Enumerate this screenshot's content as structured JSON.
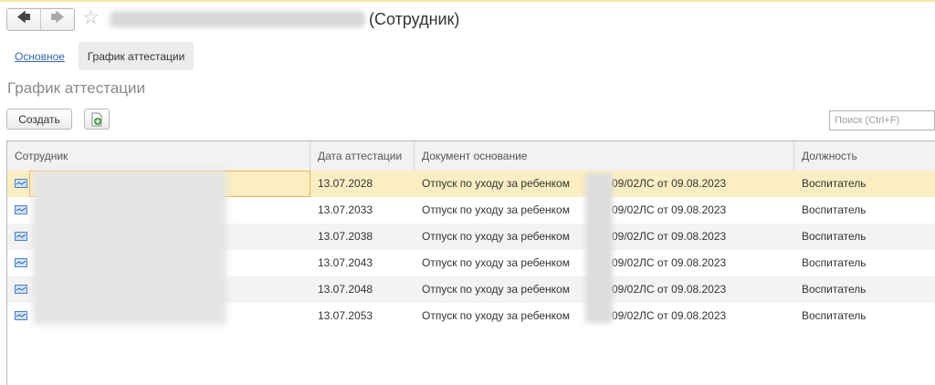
{
  "nav": {
    "back_icon": "arrow-left-icon",
    "forward_icon": "arrow-right-icon",
    "favorite_icon": "star-icon"
  },
  "header": {
    "title": "(Сотрудник)"
  },
  "tabs": [
    {
      "label": "Основное",
      "active": false
    },
    {
      "label": "График аттестации",
      "active": true
    }
  ],
  "section": {
    "title": "График аттестации"
  },
  "toolbar": {
    "create_label": "Создать",
    "add_icon": "add-document-icon"
  },
  "search": {
    "placeholder": "Поиск (Ctrl+F)",
    "value": ""
  },
  "table": {
    "columns": [
      "Сотрудник",
      "Дата аттестации",
      "Документ основание",
      "Должность"
    ],
    "rows": [
      {
        "employee": "",
        "date": "13.07.2028",
        "doc_prefix": "Отпуск по уходу за ребенком",
        "doc_suffix": "09/02ЛС от 09.08.2023",
        "position": "Воспитатель"
      },
      {
        "employee": "",
        "date": "13.07.2033",
        "doc_prefix": "Отпуск по уходу за ребенком",
        "doc_suffix": "09/02ЛС от 09.08.2023",
        "position": "Воспитатель"
      },
      {
        "employee": "",
        "date": "13.07.2038",
        "doc_prefix": "Отпуск по уходу за ребенком",
        "doc_suffix": "09/02ЛС от 09.08.2023",
        "position": "Воспитатель"
      },
      {
        "employee": "",
        "date": "13.07.2043",
        "doc_prefix": "Отпуск по уходу за ребенком",
        "doc_suffix": "09/02ЛС от 09.08.2023",
        "position": "Воспитатель"
      },
      {
        "employee": "",
        "date": "13.07.2048",
        "doc_prefix": "Отпуск по уходу за ребенком",
        "doc_suffix": "09/02ЛС от 09.08.2023",
        "position": "Воспитатель"
      },
      {
        "employee": "",
        "date": "13.07.2053",
        "doc_prefix": "Отпуск по уходу за ребенком",
        "doc_suffix": "09/02ЛС от 09.08.2023",
        "position": "Воспитатель"
      }
    ]
  },
  "colors": {
    "selected_row": "#fbeec3",
    "focus_border": "#f0b14a",
    "link": "#3366aa"
  }
}
